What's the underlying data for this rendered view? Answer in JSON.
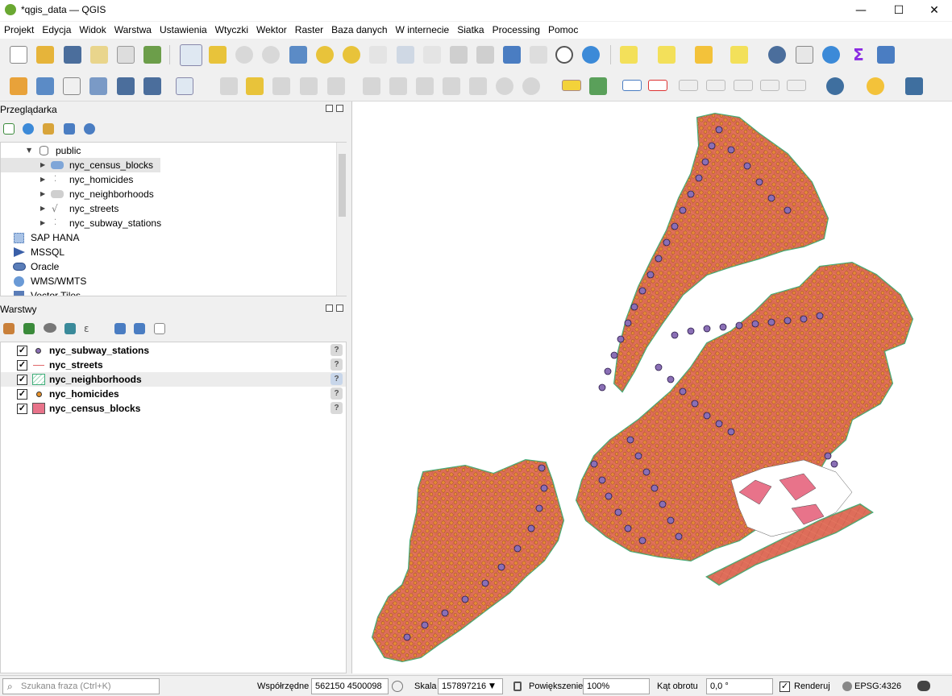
{
  "window": {
    "title": "*qgis_data — QGIS",
    "minimize": "—",
    "maximize": "☐",
    "close": "✕"
  },
  "menu": [
    "Projekt",
    "Edycja",
    "Widok",
    "Warstwa",
    "Ustawienia",
    "Wtyczki",
    "Wektor",
    "Raster",
    "Baza danych",
    "W internecie",
    "Siatka",
    "Processing",
    "Pomoc"
  ],
  "browser": {
    "title": "Przeglądarka",
    "items": [
      {
        "label": "public",
        "icon": "database-schema-icon"
      },
      {
        "label": "nyc_census_blocks",
        "icon": "polygon-layer-icon"
      },
      {
        "label": "nyc_homicides",
        "icon": "point-layer-icon"
      },
      {
        "label": "nyc_neighborhoods",
        "icon": "polygon-layer-icon"
      },
      {
        "label": "nyc_streets",
        "icon": "line-layer-icon"
      },
      {
        "label": "nyc_subway_stations",
        "icon": "point-layer-icon"
      },
      {
        "label": "SAP HANA",
        "icon": "sap-hana-icon"
      },
      {
        "label": "MSSQL",
        "icon": "mssql-icon"
      },
      {
        "label": "Oracle",
        "icon": "oracle-icon"
      },
      {
        "label": "WMS/WMTS",
        "icon": "wms-globe-icon"
      },
      {
        "label": "Vector Tiles",
        "icon": "vector-tiles-icon"
      }
    ]
  },
  "layers": {
    "title": "Warstwy",
    "items": [
      {
        "label": "nyc_subway_stations",
        "checked": true,
        "symbol": "point",
        "color": "#8a6fb5"
      },
      {
        "label": "nyc_streets",
        "checked": true,
        "symbol": "line",
        "color": "#e0686b"
      },
      {
        "label": "nyc_neighborhoods",
        "checked": true,
        "symbol": "hatch",
        "color": "#3fae7a"
      },
      {
        "label": "nyc_homicides",
        "checked": true,
        "symbol": "point",
        "color": "#e8922b"
      },
      {
        "label": "nyc_census_blocks",
        "checked": true,
        "symbol": "fill",
        "color": "#e8738a"
      }
    ],
    "unknown_crs_mark": "?"
  },
  "status": {
    "search_placeholder": "Szukana fraza (Ctrl+K)",
    "coords_label": "Współrzędne",
    "coords_value": "562150 4500098",
    "scale_label": "Skala",
    "scale_value": "157897216",
    "magnifier_label": "Powiększenie",
    "magnifier_value": "100%",
    "rotation_label": "Kąt obrotu",
    "rotation_value": "0,0 °",
    "render_label": "Renderuj",
    "crs_value": "EPSG:4326"
  },
  "colors": {
    "block_fill": "#e8738a",
    "neigh_outline": "#3fae7a",
    "homicide": "#e8922b",
    "subway": "#8a6fb5"
  }
}
